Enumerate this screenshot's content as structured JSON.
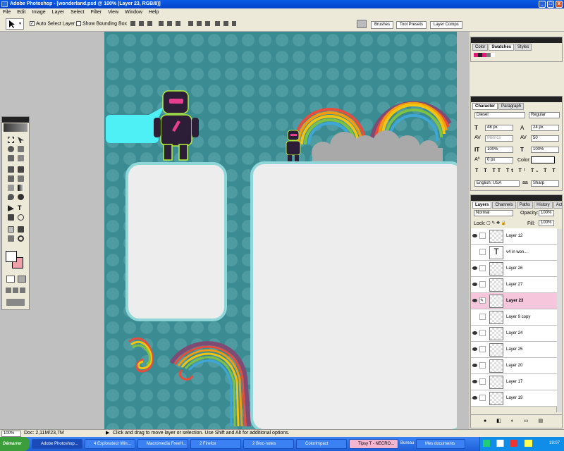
{
  "window": {
    "title": "Adobe Photoshop - [wonderland.psd @ 100% (Layer 23, RGB/8)]"
  },
  "menu": [
    "File",
    "Edit",
    "Image",
    "Layer",
    "Select",
    "Filter",
    "View",
    "Window",
    "Help"
  ],
  "options": {
    "auto_select": "Auto Select Layer",
    "bounding_box": "Show Bounding Box",
    "tabs": [
      "Brushes",
      "Tool Presets",
      "Layer Comps"
    ]
  },
  "swatches_panel": {
    "tabs": [
      "Color",
      "Swatches",
      "Styles"
    ]
  },
  "character_panel": {
    "tabs": [
      "Character",
      "Paragraph"
    ],
    "font": "Diesel",
    "style": "Regular",
    "size": "48 px",
    "leading": "24 px",
    "kerning": "Metrics",
    "tracking": "50",
    "vscale": "100%",
    "hscale": "100%",
    "baseline": "0 px",
    "color_label": "Color:",
    "language": "English: USA",
    "aa": "Sharp"
  },
  "layers_panel": {
    "tabs": [
      "Layers",
      "Channels",
      "Paths",
      "History",
      "Actions"
    ],
    "blend": "Normal",
    "opacity_label": "Opacity:",
    "opacity": "100%",
    "lock_label": "Lock:",
    "fill_label": "Fill:",
    "fill": "100%",
    "layers": [
      {
        "name": "Layer 12",
        "visible": true,
        "type": "pixel"
      },
      {
        "name": "v4 in won...",
        "visible": false,
        "type": "text"
      },
      {
        "name": "Layer 26",
        "visible": true,
        "type": "pixel"
      },
      {
        "name": "Layer 27",
        "visible": true,
        "type": "pixel"
      },
      {
        "name": "Layer 23",
        "visible": true,
        "type": "pixel",
        "selected": true
      },
      {
        "name": "Layer 9 copy",
        "visible": false,
        "type": "pixel"
      },
      {
        "name": "Layer 24",
        "visible": true,
        "type": "pixel"
      },
      {
        "name": "Layer 25",
        "visible": true,
        "type": "pixel"
      },
      {
        "name": "Layer 20",
        "visible": true,
        "type": "pixel"
      },
      {
        "name": "Layer 17",
        "visible": true,
        "type": "pixel"
      },
      {
        "name": "Layer 19",
        "visible": true,
        "type": "pixel"
      }
    ]
  },
  "status": {
    "zoom": "100%",
    "doc": "Doc: 2,11M/23,7M",
    "hint": "Click and drag to move layer or selection.  Use Shift and Alt for additional options."
  },
  "taskbar": {
    "start": "Démarrer",
    "items": [
      "Adobe Photoshop...",
      "4 Explorateur Win...",
      "Macromedia FreeH...",
      "2 Firefox",
      "2 Bloc-notes",
      "ColorImpact",
      "Tipsy T - NECRO...",
      "Bureau",
      "Mes documents"
    ],
    "clock": "19:07"
  },
  "colors": {
    "canvas": "#3A8B92",
    "selected_layer": "#F6C6DC",
    "bubble": "#4EF0F5"
  }
}
